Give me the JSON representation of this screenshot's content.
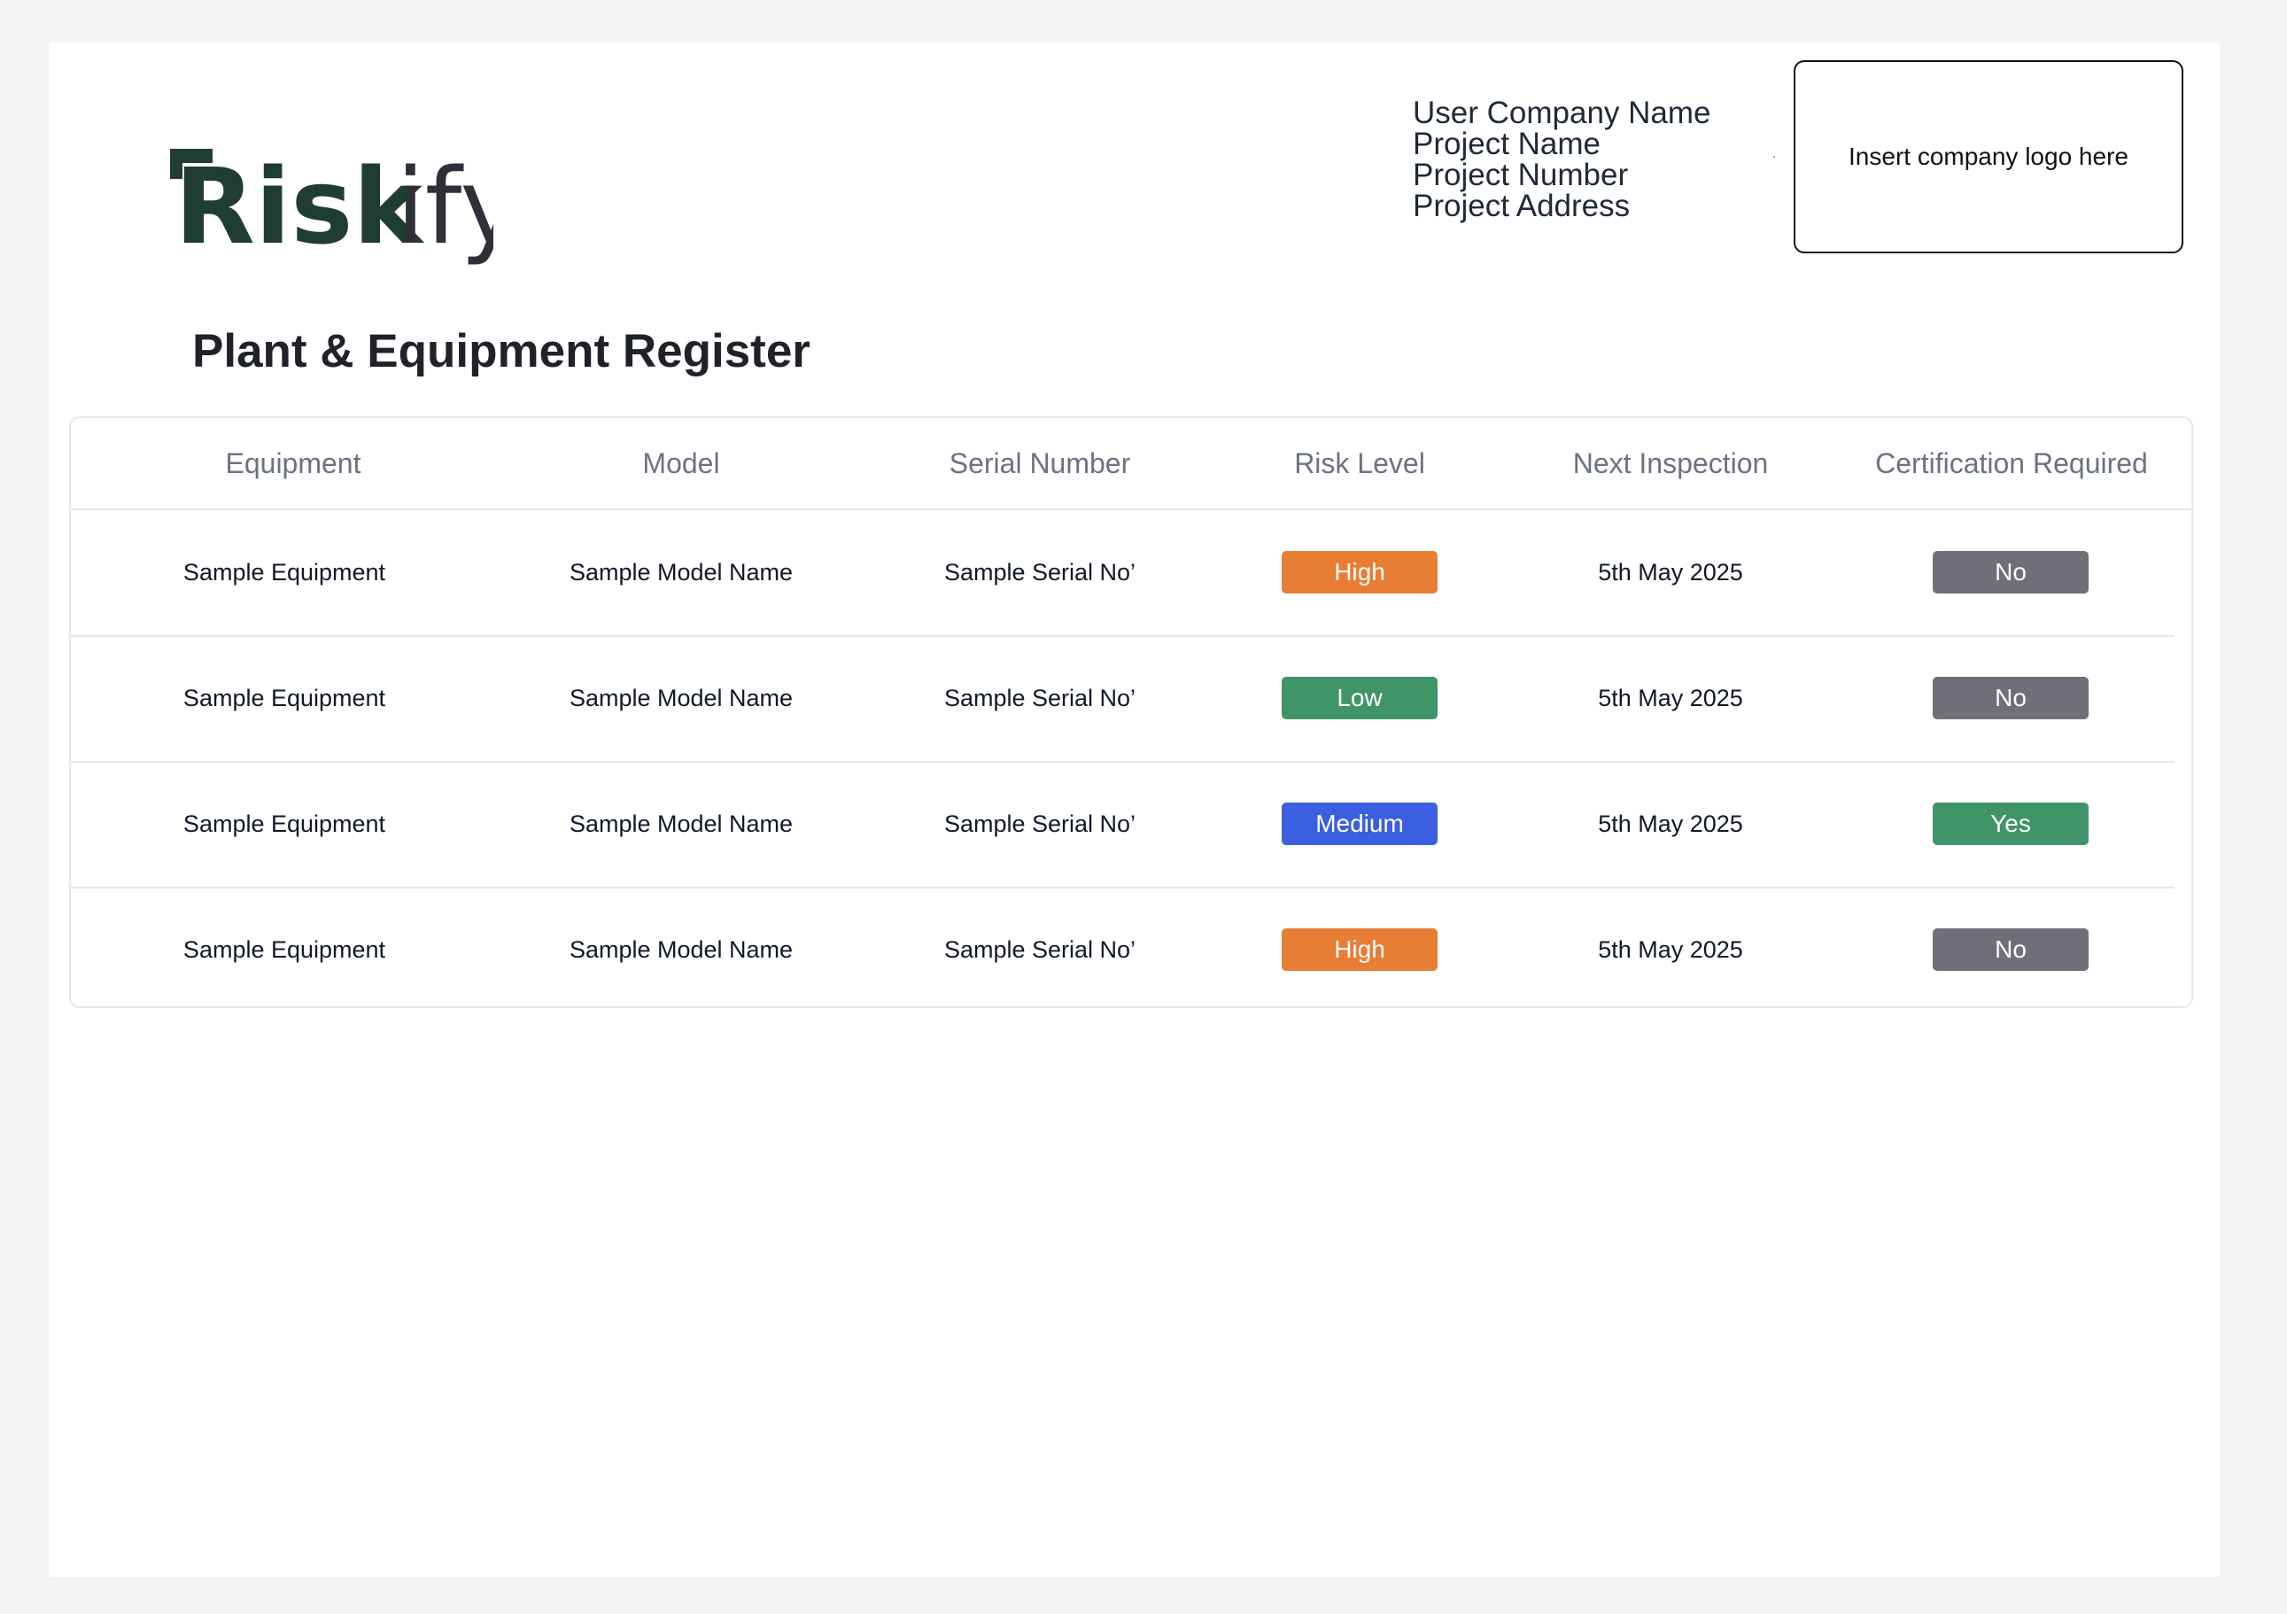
{
  "brand": {
    "name": "Riskify",
    "primary_color": "#1f3d33",
    "accent_color": "#2f2f3a"
  },
  "project_info": {
    "company": "User Company Name",
    "project_name": "Project Name",
    "project_number": "Project Number",
    "project_address": "Project Address"
  },
  "logo_placeholder": "Insert company logo here",
  "page_title": "Plant & Equipment Register",
  "table": {
    "columns": [
      "Equipment",
      "Model",
      "Serial Number",
      "Risk Level",
      "Next Inspection",
      "Certification Required"
    ],
    "rows": [
      {
        "equipment": "Sample Equipment",
        "model": "Sample Model Name",
        "serial": "Sample Serial No’",
        "risk": "High",
        "next_inspection": "5th May 2025",
        "certification": "No"
      },
      {
        "equipment": "Sample Equipment",
        "model": "Sample Model Name",
        "serial": "Sample Serial No’",
        "risk": "Low",
        "next_inspection": "5th May 2025",
        "certification": "No"
      },
      {
        "equipment": "Sample Equipment",
        "model": "Sample Model Name",
        "serial": "Sample Serial No’",
        "risk": "Medium",
        "next_inspection": "5th May 2025",
        "certification": "Yes"
      },
      {
        "equipment": "Sample Equipment",
        "model": "Sample Model Name",
        "serial": "Sample Serial No’",
        "risk": "High",
        "next_inspection": "5th May 2025",
        "certification": "No"
      }
    ]
  },
  "colors": {
    "risk_high": "#e87d35",
    "risk_low": "#3f9468",
    "risk_medium": "#3a5fe0",
    "cert_no": "#6f6f78",
    "cert_yes": "#3f9468"
  }
}
